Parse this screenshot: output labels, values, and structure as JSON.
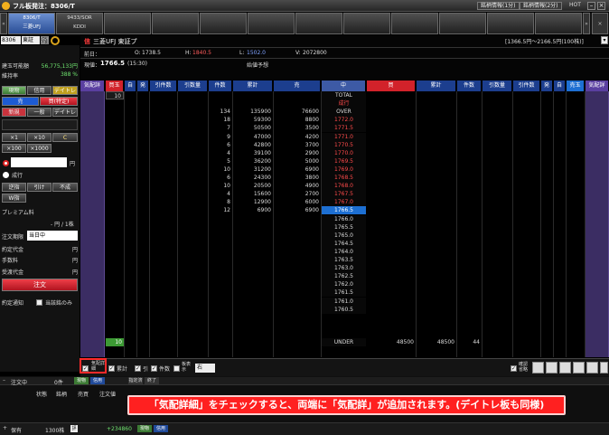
{
  "window": {
    "title": "フル板発注：8306/T",
    "btn1": "銘柄情報(1分)",
    "btn2": "銘柄情報(2分)",
    "hot": "HOT"
  },
  "tabs": [
    {
      "code": "8306/T",
      "name": "三菱UFJ"
    },
    {
      "code": "9433/SOR",
      "name": "KDDI"
    },
    {
      "code": "",
      "name": ""
    },
    {
      "code": "",
      "name": ""
    },
    {
      "code": "",
      "name": ""
    },
    {
      "code": "",
      "name": ""
    },
    {
      "code": "",
      "name": ""
    },
    {
      "code": "",
      "name": ""
    },
    {
      "code": "",
      "name": ""
    },
    {
      "code": "",
      "name": ""
    },
    {
      "code": "",
      "name": ""
    }
  ],
  "symbol": {
    "code": "8306",
    "market": "東証",
    "sor": "SOR OFF",
    "name": "三菱UFJ 東証プ",
    "range": "[1366.5円～2166.5円(100株)]"
  },
  "account": {
    "label1": "建玉可能額",
    "value1": "56,775,133円",
    "label2": "維持率",
    "value2": "388 %"
  },
  "quote": {
    "prev_label": "前日：",
    "o_label": "O:",
    "o": "1738.5",
    "h_label": "H:",
    "h": "1840.5",
    "l_label": "L:",
    "l": "1502.0",
    "v_label": "V:",
    "v": "2072800",
    "now_label": "現値：",
    "now": "1766.5",
    "time": "(15:30)",
    "itayose": "始値予想"
  },
  "order": {
    "tab_spot": "現物",
    "tab_margin": "信用",
    "tab_day": "デイトレ",
    "sell": "売",
    "buy": "買(特定)",
    "new": "新規",
    "ippan": "一般",
    "daytra": "デイトレ",
    "x1": "×1",
    "x10": "×10",
    "c": "C",
    "x100": "×100",
    "x1000": "×1000",
    "yen": "円",
    "naribuki": "成行",
    "gyakusashi": "逆指",
    "hikenari": "引け",
    "funari": "不成",
    "w": "W指",
    "premium": "プレミアム料",
    "premium_val": "- 円 / 1株",
    "kigen_label": "注文期限",
    "kigen": "当日中",
    "yakujo_label": "約定代金",
    "tesuryo_label": "手数料",
    "uketori_label": "受渡代金",
    "submit": "注文",
    "notify": "約定通知",
    "tojitsu": "当該銘のみ"
  },
  "grid_headers": [
    "気配詳",
    "買玉",
    "自",
    "発",
    "引件数",
    "引数量",
    "件数",
    "累計",
    "売",
    "中",
    "買",
    "累計",
    "件数",
    "引数量",
    "引件数",
    "発",
    "自",
    "売玉",
    "気配詳"
  ],
  "top_rows": {
    "top_box": "10",
    "total": "TOTAL",
    "nari": "成行",
    "over": "OVER"
  },
  "sell_rows": [
    {
      "cnt": "134",
      "cum": "135900",
      "qty": "76600",
      "price": ""
    },
    {
      "cnt": "18",
      "cum": "59300",
      "qty": "8800",
      "price": "1772.0"
    },
    {
      "cnt": "7",
      "cum": "50500",
      "qty": "3500",
      "price": "1771.5"
    },
    {
      "cnt": "9",
      "cum": "47000",
      "qty": "4200",
      "price": "1771.0"
    },
    {
      "cnt": "6",
      "cum": "42800",
      "qty": "3700",
      "price": "1770.5"
    },
    {
      "cnt": "4",
      "cum": "39100",
      "qty": "2900",
      "price": "1770.0"
    },
    {
      "cnt": "5",
      "cum": "36200",
      "qty": "5000",
      "price": "1769.5"
    },
    {
      "cnt": "10",
      "cum": "31200",
      "qty": "6900",
      "price": "1769.0"
    },
    {
      "cnt": "6",
      "cum": "24300",
      "qty": "3800",
      "price": "1768.5"
    },
    {
      "cnt": "10",
      "cum": "20500",
      "qty": "4900",
      "price": "1768.0"
    },
    {
      "cnt": "4",
      "cum": "15600",
      "qty": "2700",
      "price": "1767.5"
    },
    {
      "cnt": "8",
      "cum": "12900",
      "qty": "6000",
      "price": "1767.0"
    },
    {
      "cnt": "12",
      "cum": "6900",
      "qty": "6900",
      "price": "1766.5"
    }
  ],
  "buy_prices": [
    "1766.0",
    "1765.5",
    "1765.0",
    "1764.5",
    "1764.0",
    "1763.5",
    "1763.0",
    "1762.5",
    "1762.0",
    "1761.5",
    "1761.0",
    "1760.5"
  ],
  "under": {
    "label": "UNDER",
    "qty": "48500",
    "cum": "48500",
    "cnt": "44",
    "bottom_box": "10"
  },
  "bottom_bar": {
    "detail": "気配詳細",
    "ruikei": "累計",
    "hiki": "引",
    "kensu": "件数",
    "hyoji": "板表示",
    "hyoji_val": "右",
    "kakunin": "確認省略"
  },
  "footer": {
    "r1c1": "注文中",
    "r1c2": "0件",
    "r1c3": "現物",
    "r1c4": "信用",
    "r1c5": "指定済",
    "r1c6": "終了",
    "r2c1": "状態",
    "r2c2": "銘柄",
    "r2c3": "売買",
    "r2c4": "注文値",
    "r3c1": "保有",
    "r3c2": "1300株",
    "r3c3": "評",
    "r3c4": "+234860",
    "r3c5": "現物",
    "r3c6": "信用"
  },
  "callout": "「気配詳細」をチェックすると、両端に「気配詳」が追加されます。(デイトレ板も同様)"
}
